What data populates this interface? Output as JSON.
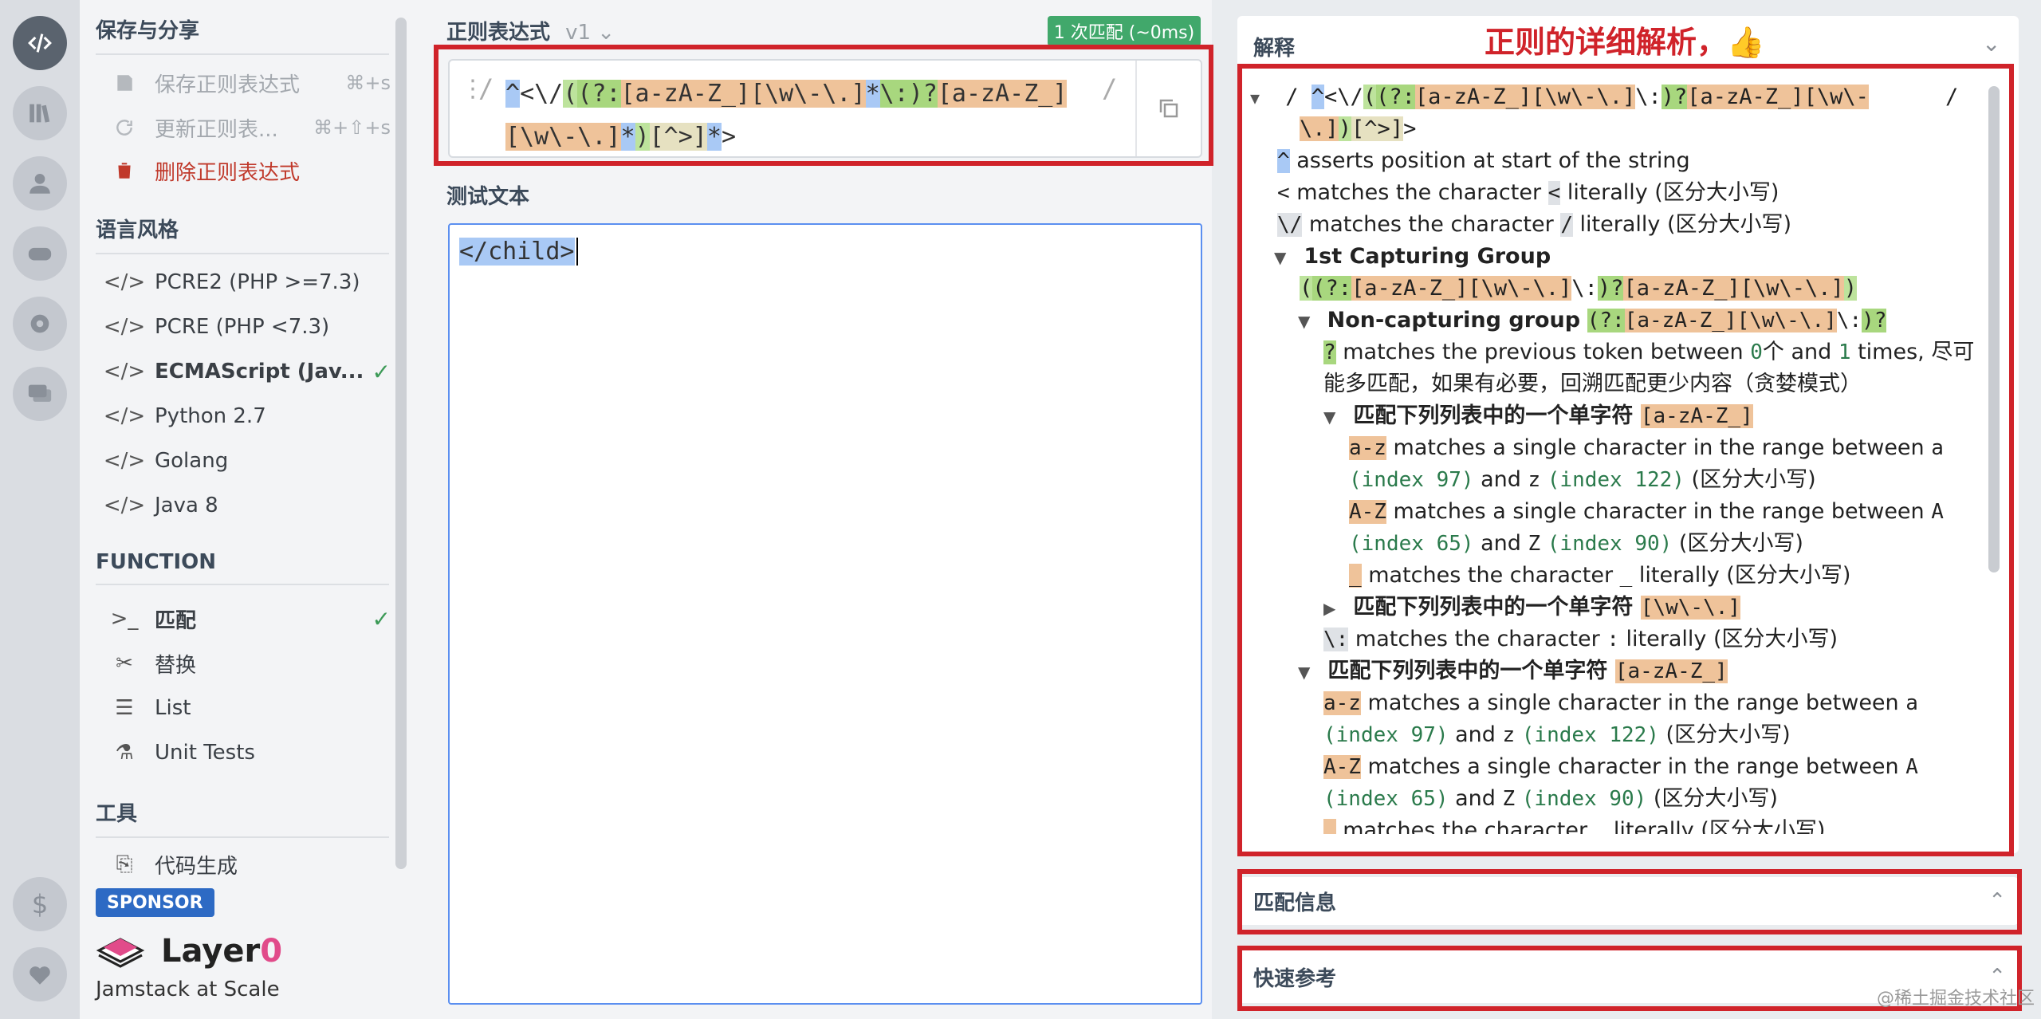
{
  "rail": {
    "icons": [
      "code-icon",
      "library-icon",
      "user-icon",
      "gamepad-icon",
      "gear-icon",
      "chat-icon",
      "dollar-icon",
      "heart-icon"
    ]
  },
  "sidebar": {
    "save_share": "保存与分享",
    "save_label": "保存正则表达式",
    "save_kb": "⌘+s",
    "update_label": "更新正则表...",
    "update_kb": "⌘+⇧+s",
    "delete_label": "删除正则表达式",
    "flavor_title": "语言风格",
    "flavors": [
      "PCRE2 (PHP >=7.3)",
      "PCRE (PHP <7.3)",
      "ECMAScript (Jav...",
      "Python 2.7",
      "Golang",
      "Java 8"
    ],
    "function_title": "FUNCTION",
    "functions": [
      "匹配",
      "替换",
      "List",
      "Unit Tests"
    ],
    "tools_title": "工具",
    "codegen": "代码生成",
    "sponsor": "SPONSOR",
    "layer_name": "Layer",
    "layer_zero": "0",
    "layer_tag": "Jamstack at Scale"
  },
  "regex": {
    "title": "正则表达式",
    "version": "v1",
    "match_badge": "1 次匹配 (~0ms)",
    "delim_open": "/",
    "delim_close": "/"
  },
  "test": {
    "title": "测试文本",
    "text": "</child>"
  },
  "explain": {
    "title": "解释",
    "annotation": "正则的详细解析，👍"
  },
  "match_info": {
    "title": "匹配信息"
  },
  "quick_ref": {
    "title": "快速参考"
  },
  "watermark": "@稀土掘金技术社区"
}
